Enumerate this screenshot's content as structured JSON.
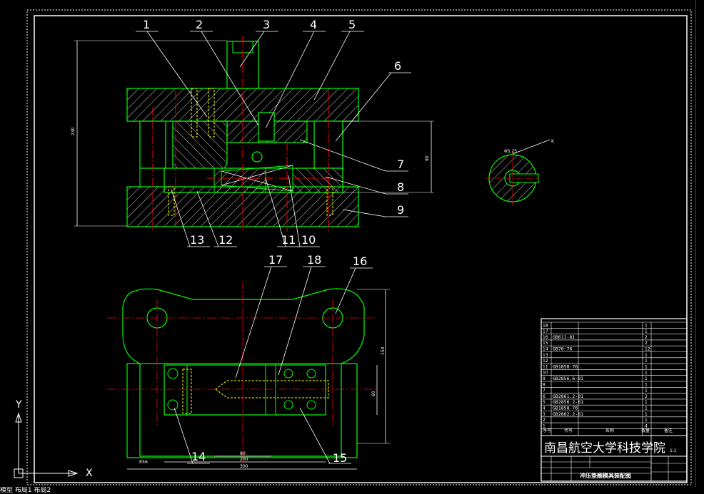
{
  "drawing": {
    "callouts_top": [
      "1",
      "2",
      "3",
      "4",
      "5",
      "6",
      "7",
      "8",
      "9",
      "10",
      "11",
      "12",
      "13"
    ],
    "callouts_bottom": [
      "14",
      "15",
      "16",
      "17",
      "18"
    ],
    "dimensions": {
      "overall_height": "230",
      "right_height": "90",
      "plan_height_outer": "150",
      "plan_height_inner": "60",
      "width_a": "80",
      "width_b": "200",
      "width_c": "300",
      "left_small": "R56"
    },
    "detail_label": "K",
    "detail_dims": "Φ5.25"
  },
  "title_block": {
    "school": "南昌航空大学科技学院",
    "drawing_name": "冲压垫圈模具装配图",
    "scale": "1:1",
    "headers": {
      "no": "序号",
      "code": "代号",
      "name": "名称",
      "qty": "数量",
      "remark": "备注"
    },
    "rows": [
      {
        "no": "18",
        "code": "",
        "qty": "1"
      },
      {
        "no": "17",
        "code": "",
        "qty": "1"
      },
      {
        "no": "16",
        "code": "GB611-81",
        "qty": "2"
      },
      {
        "no": "15",
        "code": "",
        "qty": "2"
      },
      {
        "no": "14",
        "code": "GB70-76",
        "qty": "12"
      },
      {
        "no": "13",
        "code": "",
        "qty": "1"
      },
      {
        "no": "12",
        "code": "",
        "qty": "1"
      },
      {
        "no": "11",
        "code": "GB1858-76",
        "qty": "1"
      },
      {
        "no": "10",
        "code": "",
        "qty": "1"
      },
      {
        "no": "9",
        "code": "GB2856.6-81",
        "qty": "1"
      },
      {
        "no": "8",
        "code": "",
        "qty": "1"
      },
      {
        "no": "7",
        "code": "",
        "qty": "1"
      },
      {
        "no": "6",
        "code": "GB2861.2-81",
        "qty": "2"
      },
      {
        "no": "5",
        "code": "GB2856.2-81",
        "qty": "1"
      },
      {
        "no": "4",
        "code": "GB1858-76",
        "qty": "1"
      },
      {
        "no": "3",
        "code": "GB2862.2-81",
        "qty": "1"
      },
      {
        "no": "2",
        "code": "",
        "qty": "1"
      },
      {
        "no": "1",
        "code": "",
        "qty": "4"
      }
    ]
  },
  "ucs": {
    "x_label": "X",
    "y_label": "Y"
  },
  "command_line": "模型 布局1 布局2"
}
